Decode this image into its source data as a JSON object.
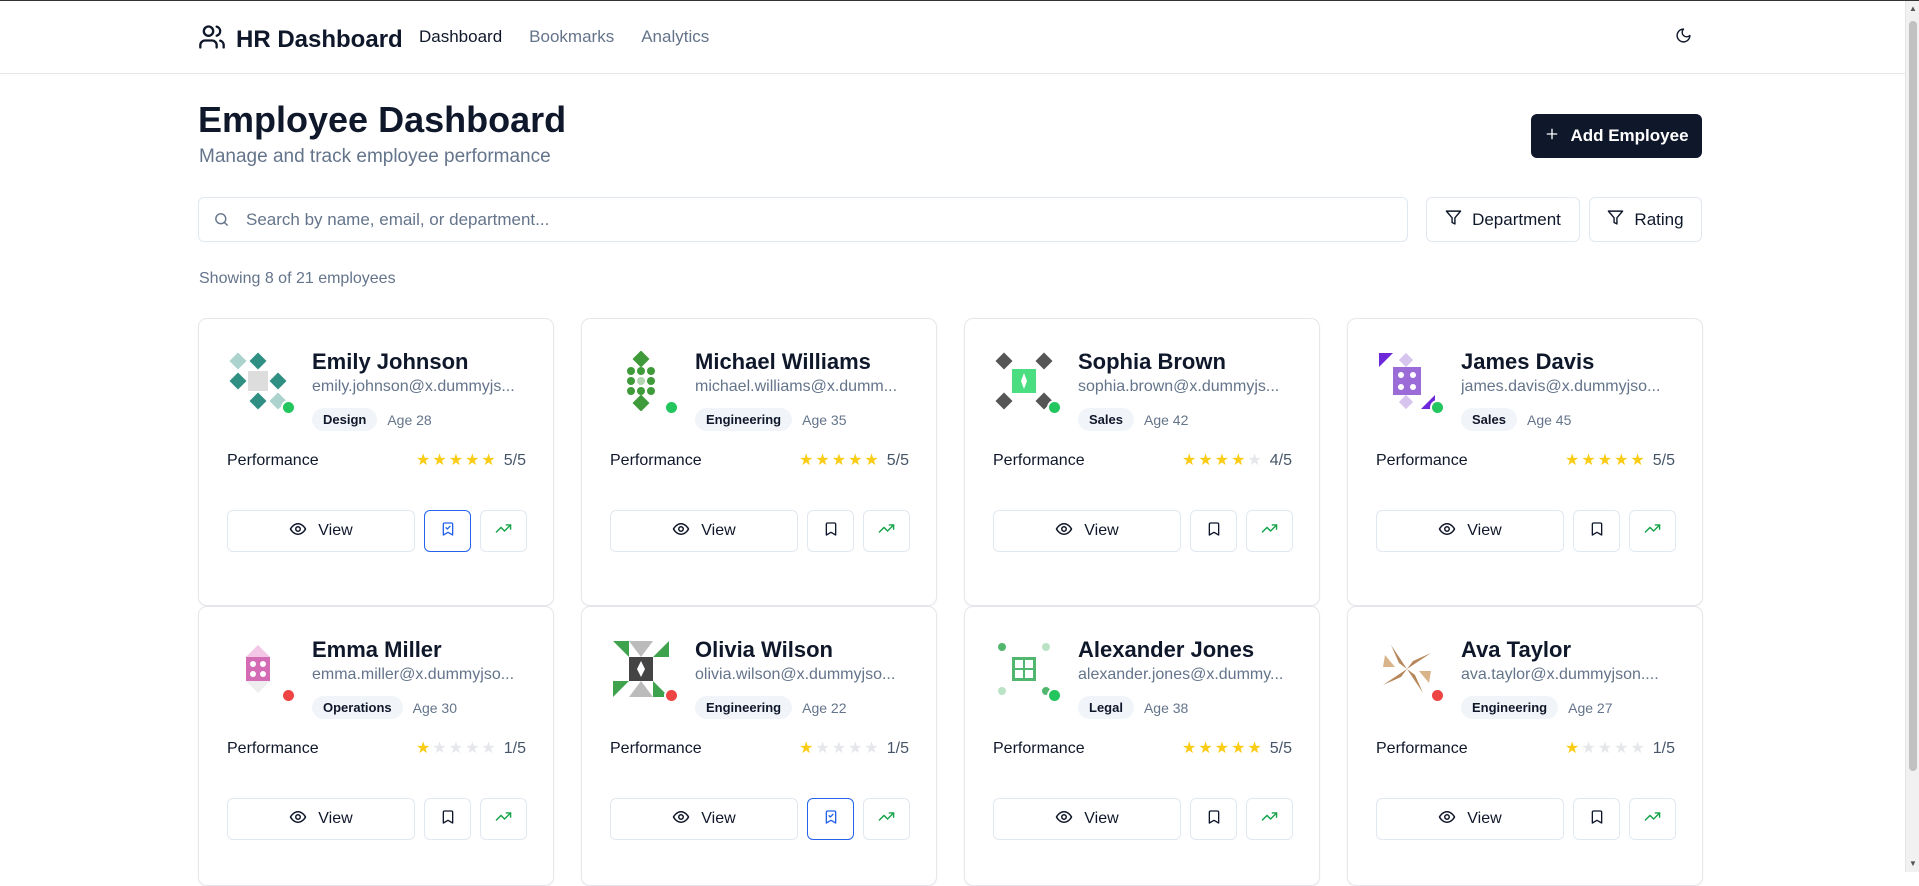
{
  "header": {
    "brand": "HR Dashboard",
    "nav": [
      {
        "label": "Dashboard",
        "active": true
      },
      {
        "label": "Bookmarks",
        "active": false
      },
      {
        "label": "Analytics",
        "active": false
      }
    ],
    "theme_icon": "moon-icon"
  },
  "page": {
    "title": "Employee Dashboard",
    "subtitle": "Manage and track employee performance",
    "add_button": "Add Employee"
  },
  "search": {
    "placeholder": "Search by name, email, or department...",
    "value": ""
  },
  "filters": {
    "department": "Department",
    "rating": "Rating"
  },
  "summary": "Showing 8 of 21 employees",
  "card_labels": {
    "performance": "Performance",
    "view": "View"
  },
  "colors": {
    "primary": "#0f172a",
    "muted": "#64748b",
    "star": "#facc15",
    "online": "#22c55e",
    "offline": "#ef4444",
    "trend": "#16a34a",
    "bookmark_active": "#2563eb"
  },
  "employees": [
    {
      "name": "Emily Johnson",
      "email": "emily.johnson@x.dummyjs...",
      "department": "Design",
      "age": "Age 28",
      "rating": 5,
      "rating_text": "5/5",
      "status": "online",
      "bookmarked": true,
      "avatar_color": "#2f8f83"
    },
    {
      "name": "Michael Williams",
      "email": "michael.williams@x.dumm...",
      "department": "Engineering",
      "age": "Age 35",
      "rating": 5,
      "rating_text": "5/5",
      "status": "online",
      "bookmarked": false,
      "avatar_color": "#3f9a3a"
    },
    {
      "name": "Sophia Brown",
      "email": "sophia.brown@x.dummyjs...",
      "department": "Sales",
      "age": "Age 42",
      "rating": 4,
      "rating_text": "4/5",
      "status": "online",
      "bookmarked": false,
      "avatar_color": "#555555"
    },
    {
      "name": "James Davis",
      "email": "james.davis@x.dummyjso...",
      "department": "Sales",
      "age": "Age 45",
      "rating": 5,
      "rating_text": "5/5",
      "status": "online",
      "bookmarked": false,
      "avatar_color": "#9b6bd8"
    },
    {
      "name": "Emma Miller",
      "email": "emma.miller@x.dummyjso...",
      "department": "Operations",
      "age": "Age 30",
      "rating": 1,
      "rating_text": "1/5",
      "status": "offline",
      "bookmarked": false,
      "avatar_color": "#d46bb5"
    },
    {
      "name": "Olivia Wilson",
      "email": "olivia.wilson@x.dummyjso...",
      "department": "Engineering",
      "age": "Age 22",
      "rating": 1,
      "rating_text": "1/5",
      "status": "offline",
      "bookmarked": true,
      "avatar_color": "#3fa34d"
    },
    {
      "name": "Alexander Jones",
      "email": "alexander.jones@x.dummy...",
      "department": "Legal",
      "age": "Age 38",
      "rating": 5,
      "rating_text": "5/5",
      "status": "online",
      "bookmarked": false,
      "avatar_color": "#52b76e"
    },
    {
      "name": "Ava Taylor",
      "email": "ava.taylor@x.dummyjson....",
      "department": "Engineering",
      "age": "Age 27",
      "rating": 1,
      "rating_text": "1/5",
      "status": "offline",
      "bookmarked": false,
      "avatar_color": "#b5875a"
    }
  ]
}
